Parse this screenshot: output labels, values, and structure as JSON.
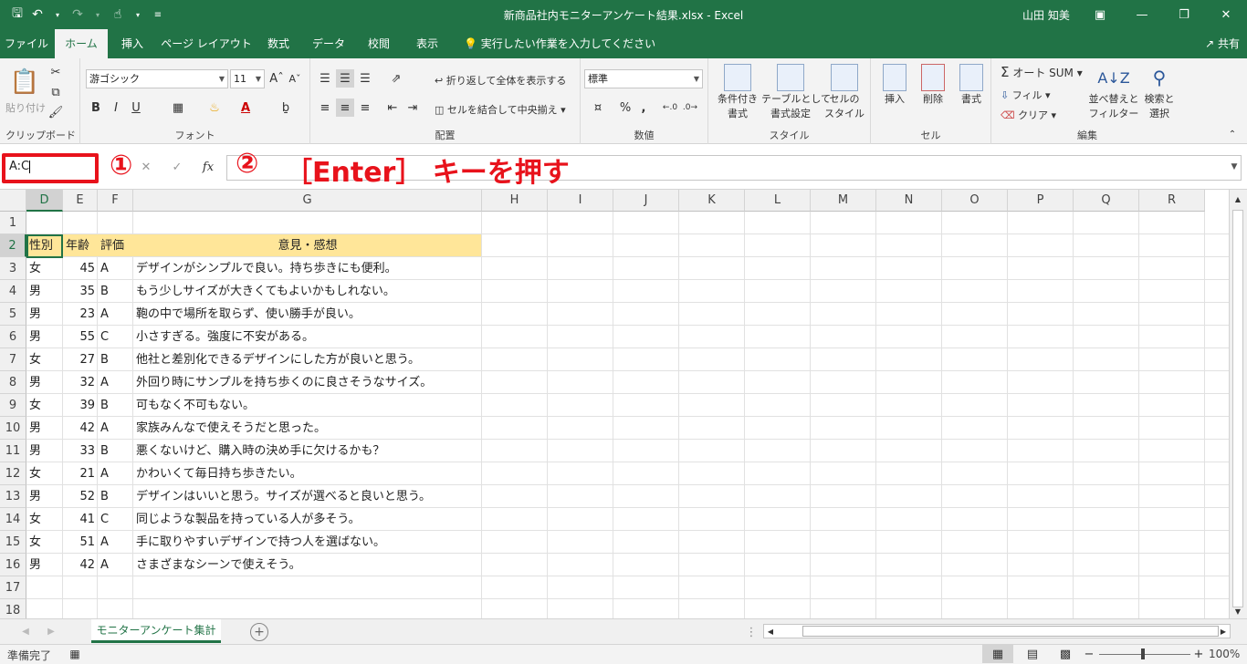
{
  "titlebar": {
    "title": "新商品社内モニターアンケート結果.xlsx  -  Excel",
    "user": "山田 知美",
    "icons": [
      "save-icon",
      "undo-icon",
      "redo-icon",
      "touch-mode-icon",
      "customize-qat-icon"
    ]
  },
  "tabs": [
    "ファイル",
    "ホーム",
    "挿入",
    "ページ レイアウト",
    "数式",
    "データ",
    "校閲",
    "表示"
  ],
  "tell_me": "実行したい作業を入力してください",
  "share": "共有",
  "ribbon": {
    "clipboard": {
      "paste": "貼り付け",
      "label": "クリップボード"
    },
    "font": {
      "name": "游ゴシック",
      "size": "11",
      "bold": "B",
      "italic": "I",
      "underline": "U",
      "label": "フォント"
    },
    "alignment": {
      "wrap": "折り返して全体を表示する",
      "merge": "セルを結合して中央揃え",
      "label": "配置"
    },
    "number": {
      "format": "標準",
      "percent": "%",
      "comma": ",",
      "label": "数値"
    },
    "styles": {
      "conditional": [
        "条件付き",
        "書式"
      ],
      "table": [
        "テーブルとして",
        "書式設定"
      ],
      "cell": [
        "セルの",
        "スタイル"
      ],
      "label": "スタイル"
    },
    "cells": {
      "insert": "挿入",
      "delete": "削除",
      "format": "書式",
      "label": "セル"
    },
    "editing": {
      "autosum": "オート SUM",
      "fill": "フィル",
      "clear": "クリア",
      "sort": [
        "並べ替えと",
        "フィルター"
      ],
      "find": [
        "検索と",
        "選択"
      ],
      "label": "編集"
    }
  },
  "namebox": {
    "value": "A:C"
  },
  "fx": "fx",
  "annotation": {
    "step1": "①",
    "step2": "②",
    "text": "［Enter］ キーを押す"
  },
  "columns": [
    "D",
    "E",
    "F",
    "G",
    "H",
    "I",
    "J",
    "K",
    "L",
    "M",
    "N",
    "O",
    "P",
    "Q",
    "R"
  ],
  "rows": [
    "1",
    "2",
    "3",
    "4",
    "5",
    "6",
    "7",
    "8",
    "9",
    "10",
    "11",
    "12",
    "13",
    "14",
    "15",
    "16",
    "17",
    "18"
  ],
  "header_row": {
    "gender": "性別",
    "age": "年齢",
    "rating": "評価",
    "comment": "意見・感想"
  },
  "records": [
    {
      "gender": "女",
      "age": "45",
      "rating": "A",
      "comment": "デザインがシンプルで良い。持ち歩きにも便利。"
    },
    {
      "gender": "男",
      "age": "35",
      "rating": "B",
      "comment": "もう少しサイズが大きくてもよいかもしれない。"
    },
    {
      "gender": "男",
      "age": "23",
      "rating": "A",
      "comment": "鞄の中で場所を取らず、使い勝手が良い。"
    },
    {
      "gender": "男",
      "age": "55",
      "rating": "C",
      "comment": "小さすぎる。強度に不安がある。"
    },
    {
      "gender": "女",
      "age": "27",
      "rating": "B",
      "comment": "他社と差別化できるデザインにした方が良いと思う。"
    },
    {
      "gender": "男",
      "age": "32",
      "rating": "A",
      "comment": "外回り時にサンプルを持ち歩くのに良さそうなサイズ。"
    },
    {
      "gender": "女",
      "age": "39",
      "rating": "B",
      "comment": "可もなく不可もない。"
    },
    {
      "gender": "男",
      "age": "42",
      "rating": "A",
      "comment": "家族みんなで使えそうだと思った。"
    },
    {
      "gender": "男",
      "age": "33",
      "rating": "B",
      "comment": "悪くないけど、購入時の決め手に欠けるかも？"
    },
    {
      "gender": "女",
      "age": "21",
      "rating": "A",
      "comment": "かわいくて毎日持ち歩きたい。"
    },
    {
      "gender": "男",
      "age": "52",
      "rating": "B",
      "comment": "デザインはいいと思う。サイズが選べると良いと思う。"
    },
    {
      "gender": "女",
      "age": "41",
      "rating": "C",
      "comment": "同じような製品を持っている人が多そう。"
    },
    {
      "gender": "女",
      "age": "51",
      "rating": "A",
      "comment": "手に取りやすいデザインで持つ人を選ばない。"
    },
    {
      "gender": "男",
      "age": "42",
      "rating": "A",
      "comment": "さまざまなシーンで使えそう。"
    }
  ],
  "sheet_tab": "モニターアンケート集計",
  "status": {
    "ready": "準備完了",
    "zoom": "100%"
  },
  "colors": {
    "excel_green": "#217346",
    "highlight": "#e8121b",
    "header_fill": "#ffe699"
  }
}
